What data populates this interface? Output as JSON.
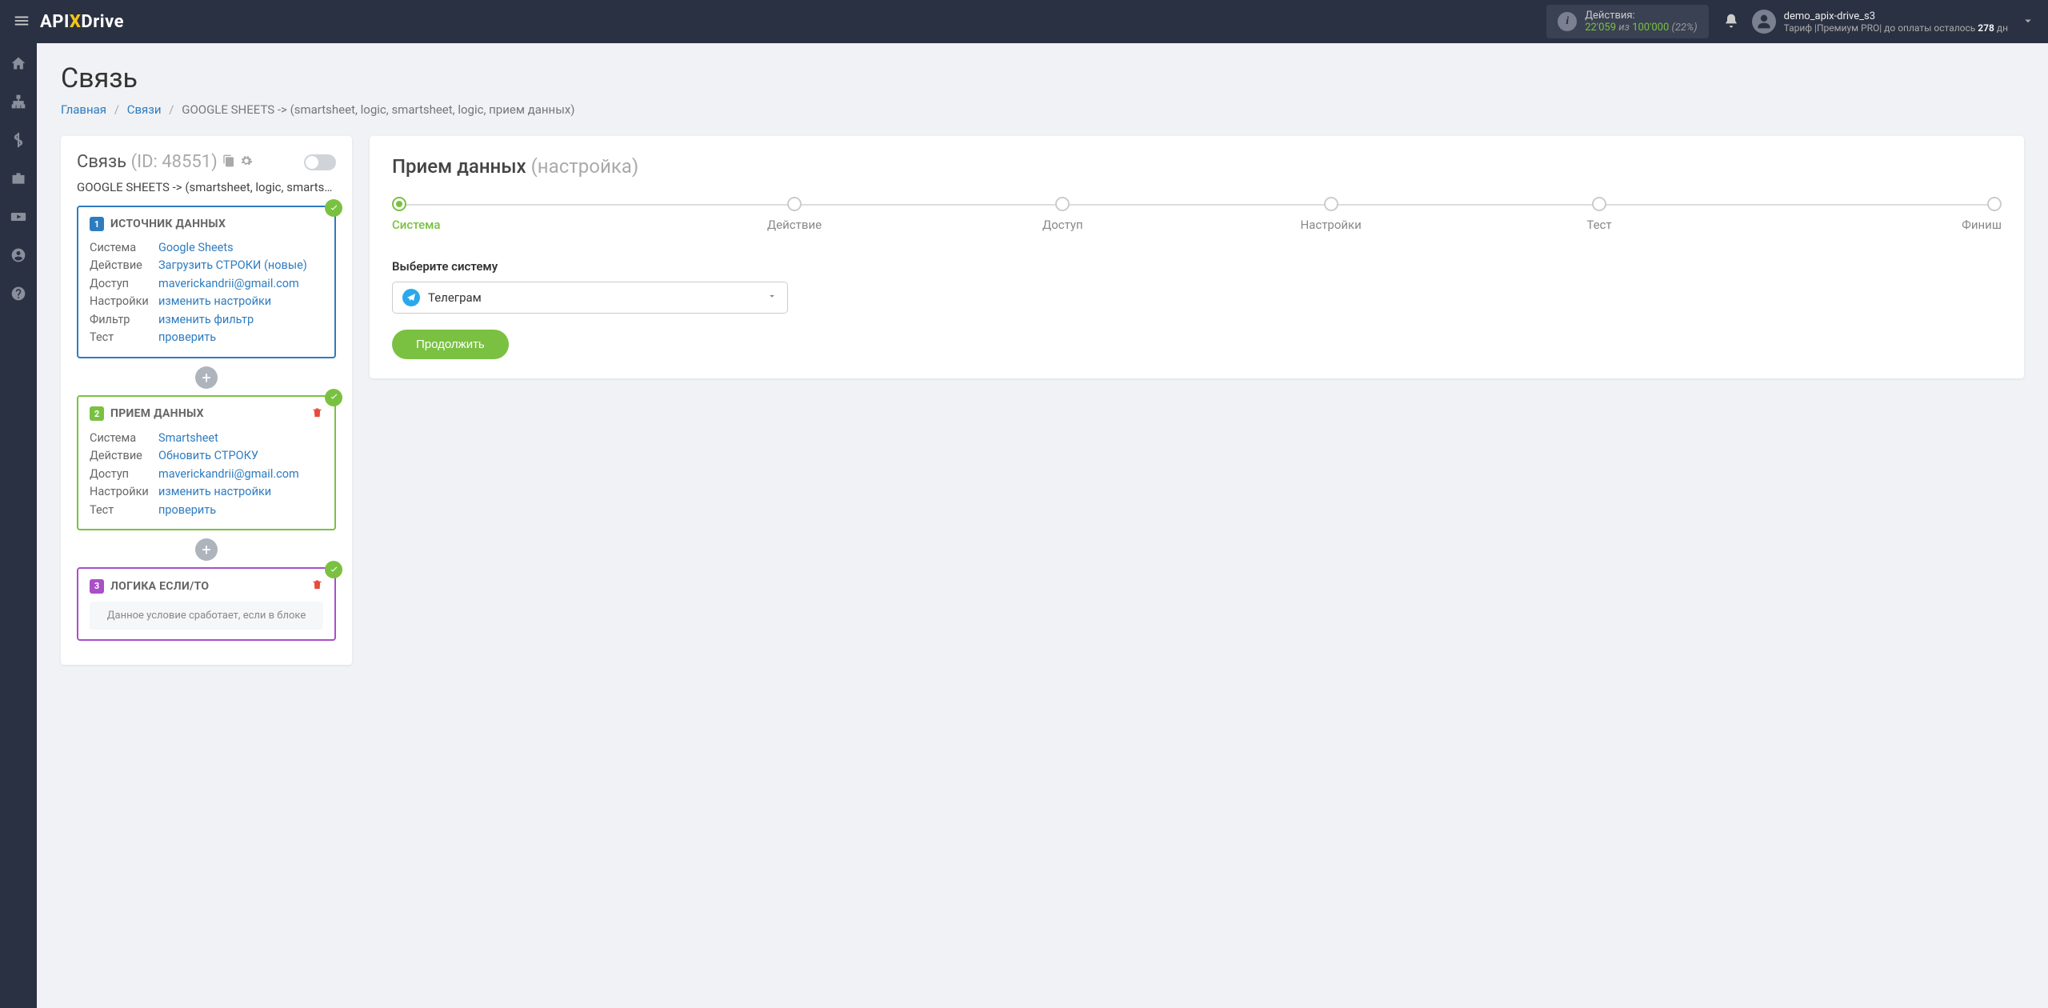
{
  "header": {
    "logo_prefix": "API",
    "logo_x": "X",
    "logo_suffix": "Drive",
    "actions_label": "Действия:",
    "actions_used": "22'059",
    "actions_iz": "из",
    "actions_total": "100'000",
    "actions_pct": "(22%)",
    "user_name": "demo_apix-drive_s3",
    "tariff_prefix": "Тариф |Премиум PRO| до оплаты осталось ",
    "tariff_days": "278",
    "tariff_suffix": " дн"
  },
  "page": {
    "title": "Связь",
    "breadcrumb_home": "Главная",
    "breadcrumb_links": "Связи",
    "breadcrumb_current": "GOOGLE SHEETS -> (smartsheet, logic, smartsheet, logic, прием данных)"
  },
  "left": {
    "title": "Связь",
    "id": "(ID: 48551)",
    "subtitle": "GOOGLE SHEETS -> (smartsheet, logic, smartshe",
    "labels": {
      "system": "Система",
      "action": "Действие",
      "access": "Доступ",
      "settings": "Настройки",
      "filter": "Фильтр",
      "test": "Тест"
    },
    "block1": {
      "num": "1",
      "title": "ИСТОЧНИК ДАННЫХ",
      "system": "Google Sheets",
      "action": "Загрузить СТРОКИ (новые)",
      "access": "maverickandrii@gmail.com",
      "settings": "изменить настройки",
      "filter": "изменить фильтр",
      "test": "проверить"
    },
    "block2": {
      "num": "2",
      "title": "ПРИЕМ ДАННЫХ",
      "system": "Smartsheet",
      "action": "Обновить СТРОКУ",
      "access": "maverickandrii@gmail.com",
      "settings": "изменить настройки",
      "test": "проверить"
    },
    "block3": {
      "num": "3",
      "title": "ЛОГИКА ЕСЛИ/ТО",
      "note": "Данное условие сработает, если в блоке"
    }
  },
  "right": {
    "title": "Прием данных",
    "title_sub": "(настройка)",
    "steps": [
      "Система",
      "Действие",
      "Доступ",
      "Настройки",
      "Тест",
      "Финиш"
    ],
    "select_label": "Выберите систему",
    "select_value": "Телеграм",
    "continue": "Продолжить"
  }
}
